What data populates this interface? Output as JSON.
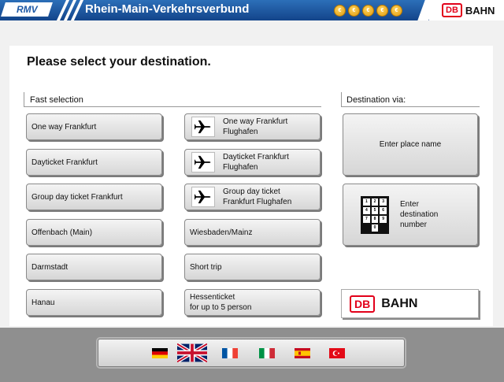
{
  "header": {
    "logo": "RMV",
    "title": "Rhein-Main-Verkehrsverbund",
    "coins": [
      "€",
      "€",
      "€",
      "€",
      "€"
    ],
    "db_box": "DB",
    "db_word": "BAHN"
  },
  "main": {
    "title": "Please select your destination.",
    "fast_selection_label": "Fast selection",
    "destination_via_label": "Destination via:"
  },
  "fast_left": [
    "One way Frankfurt",
    "Dayticket Frankfurt",
    "Group day ticket Frankfurt",
    "Offenbach (Main)",
    "Darmstadt",
    "Hanau"
  ],
  "fast_right": {
    "airport1_line1": "One way Frankfurt",
    "airport1_line2": "Flughafen",
    "airport2_line1": "Dayticket Frankfurt",
    "airport2_line2": "Flughafen",
    "airport3_line1": "Group day ticket",
    "airport3_line2": "Frankfurt Flughafen",
    "wiesbaden": "Wiesbaden/Mainz",
    "short_trip": "Short trip",
    "hessen_line1": "Hessenticket",
    "hessen_line2": "for up to 5 person"
  },
  "destination": {
    "place_name": "Enter place name",
    "number_line1": "Enter",
    "number_line2": "destination",
    "number_line3": "number",
    "keypad_keys": [
      "1",
      "2",
      "3",
      "4",
      "5",
      "6",
      "7",
      "8",
      "9",
      "",
      "0",
      ""
    ]
  },
  "db_logo": {
    "box": "DB",
    "word": "BAHN"
  },
  "languages": [
    "German",
    "English",
    "French",
    "Italian",
    "Spanish",
    "Turkish"
  ],
  "colors": {
    "header_blue": "#1f5aa6",
    "db_red": "#e2001a"
  }
}
